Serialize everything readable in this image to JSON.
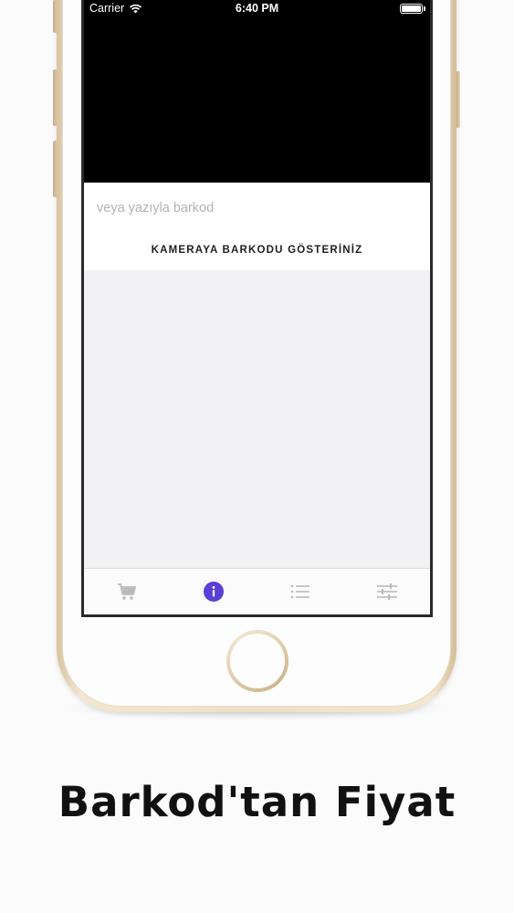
{
  "status_bar": {
    "carrier": "Carrier",
    "time": "6:40 PM",
    "battery_level": 1.0
  },
  "barcode_input": {
    "value": "",
    "placeholder": "veya yazıyla barkod"
  },
  "instruction": "KAMERAYA BARKODU GÖSTERİNİZ",
  "tabs": [
    {
      "icon": "cart-icon",
      "active": false
    },
    {
      "icon": "info-icon",
      "active": true
    },
    {
      "icon": "list-icon",
      "active": false
    },
    {
      "icon": "sliders-icon",
      "active": false
    }
  ],
  "colors": {
    "accent": "#5a3fd6",
    "tab_inactive": "#b9b9be",
    "camera_background": "#000000",
    "content_background": "#f2f2f4"
  },
  "caption": "Barkod'tan Fiyat"
}
